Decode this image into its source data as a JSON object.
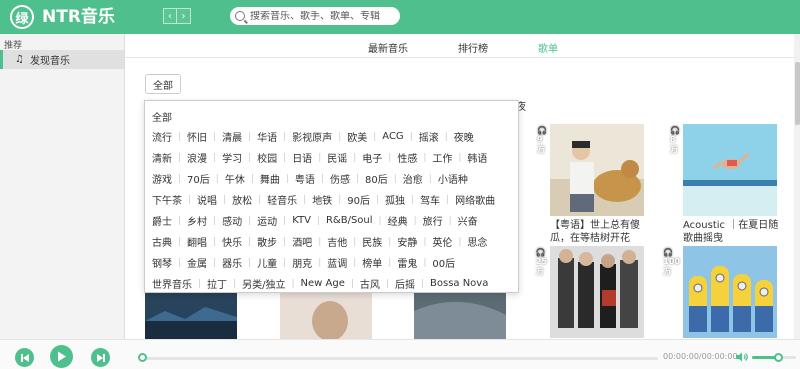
{
  "header": {
    "logo_char": "绿",
    "title": "NTR音乐",
    "back": "‹",
    "forward": "›",
    "search_placeholder": "搜索音乐、歌手、歌单、专辑",
    "accent": "#4fc08d"
  },
  "sidebar": {
    "heading": "推荐",
    "items": [
      {
        "label": "发现音乐",
        "icon": "music-note-icon",
        "glyph": "♫",
        "active": true
      }
    ]
  },
  "tabs": [
    {
      "label": "最新音乐",
      "active": false
    },
    {
      "label": "排行榜",
      "active": false
    },
    {
      "label": "歌单",
      "active": true
    }
  ],
  "filter": {
    "all_label": "全部"
  },
  "popup": {
    "all_label": "全部",
    "rows": [
      [
        "流行",
        "怀旧",
        "清晨",
        "华语",
        "影视原声",
        "欧美",
        "ACG",
        "摇滚",
        "夜晚"
      ],
      [
        "清新",
        "浪漫",
        "学习",
        "校园",
        "日语",
        "民谣",
        "电子",
        "性感",
        "工作",
        "韩语"
      ],
      [
        "游戏",
        "70后",
        "午休",
        "舞曲",
        "粤语",
        "伤感",
        "80后",
        "治愈",
        "小语种"
      ],
      [
        "下午茶",
        "说唱",
        "放松",
        "轻音乐",
        "地铁",
        "90后",
        "孤独",
        "驾车",
        "网络歌曲"
      ],
      [
        "爵士",
        "乡村",
        "感动",
        "运动",
        "KTV",
        "R&B/Soul",
        "经典",
        "旅行",
        "兴奋"
      ],
      [
        "古典",
        "翻唱",
        "快乐",
        "散步",
        "酒吧",
        "吉他",
        "民族",
        "安静",
        "英伦",
        "思念"
      ],
      [
        "钢琴",
        "金属",
        "器乐",
        "儿童",
        "朋克",
        "蓝调",
        "榜单",
        "雷鬼",
        "00后"
      ],
      [
        "世界音乐",
        "拉丁",
        "另类/独立",
        "New Age",
        "古风",
        "后摇",
        "Bossa Nova"
      ]
    ]
  },
  "cards": [
    {
      "count": "9万",
      "title": "【粤语】世上总有傻瓜，在等桔树开花"
    },
    {
      "count": "8万",
      "title": "Acoustic ｜在夏日随歌曲摇曳"
    },
    {
      "count": "25万",
      "title": ""
    },
    {
      "count": "100万",
      "title": ""
    }
  ],
  "partial_char": "夜",
  "player": {
    "time": "00:00:00/00:00:00",
    "progress": 0,
    "volume": 0.6
  }
}
